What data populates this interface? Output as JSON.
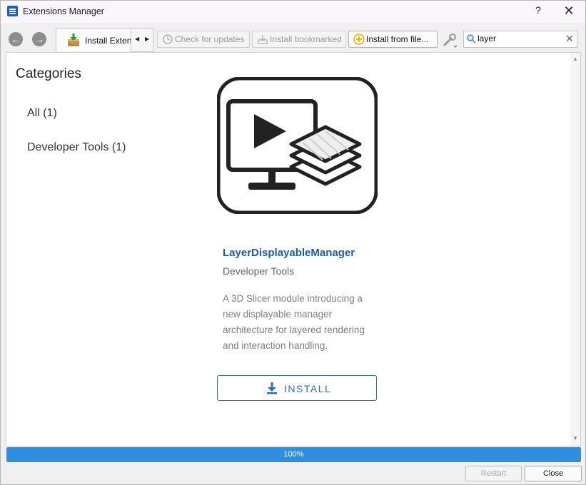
{
  "window": {
    "title": "Extensions Manager",
    "help_label": "?",
    "close_label": "✕"
  },
  "toolbar": {
    "back_icon": "back-arrow-icon",
    "forward_icon": "forward-arrow-icon",
    "tab_label": "Install Extensions",
    "check_updates_label": "Check for updates",
    "install_bookmarked_label": "Install bookmarked",
    "install_from_file_label": "Install from file...",
    "search_value": "layer"
  },
  "sidebar": {
    "title": "Categories",
    "items": [
      {
        "label": "All (1)"
      },
      {
        "label": "Developer Tools (1)"
      }
    ]
  },
  "extension": {
    "name": "LayerDisplayableManager",
    "category": "Developer Tools",
    "description": "A 3D Slicer module introducing a new displayable manager architecture for layered rendering and interaction handling.",
    "install_label": "INSTALL"
  },
  "progress": {
    "value": 1.0,
    "text": "100%"
  },
  "footer": {
    "restart_label": "Restart",
    "close_label": "Close"
  },
  "colors": {
    "accent": "#2a6fbe",
    "link": "#1e5aa8",
    "progress": "#2f8ee0"
  }
}
